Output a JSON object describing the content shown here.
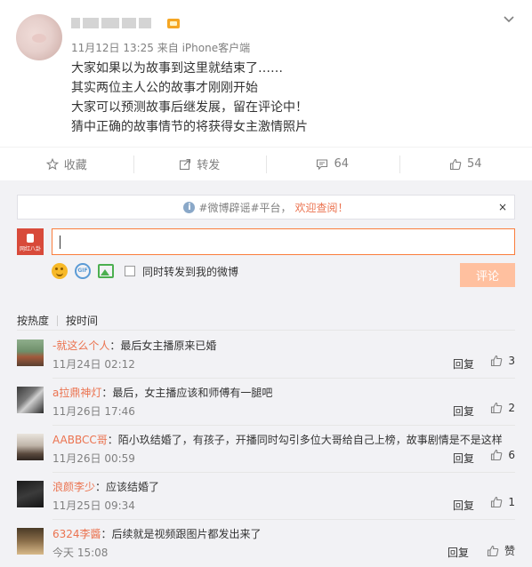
{
  "post": {
    "meta": "11月12日 13:25 来自 iPhone客户端",
    "lines": [
      "大家如果以为故事到这里就结束了……",
      "其实两位主人公的故事才刚刚开始",
      "大家可以预测故事后继发展，留在评论中！",
      "猜中正确的故事情节的将获得女主激情照片"
    ]
  },
  "actions": {
    "favorite_label": "收藏",
    "forward_label": "转发",
    "comment_count": "64",
    "like_count": "54"
  },
  "notice": {
    "prefix": "#微博辟谣#平台，",
    "link": "欢迎查阅！",
    "close": "×"
  },
  "composer": {
    "avatar_text": "网红八卦",
    "forward_option": "同时转发到我的微博",
    "submit_label": "评论"
  },
  "sort": {
    "hot": "按热度",
    "time": "按时间"
  },
  "comments": [
    {
      "user": "-就这么个人",
      "text": "：最后女主播原来已婚",
      "time": "11月24日 02:12",
      "reply": "回复",
      "likes": "3"
    },
    {
      "user": "a拉鼎神灯",
      "text": "：最后，女主播应该和师傅有一腿吧",
      "time": "11月26日 17:46",
      "reply": "回复",
      "likes": "2"
    },
    {
      "user": "AABBCC哥",
      "text": "：陌小玖结婚了，有孩子，开播同时勾引多位大哥给自己上榜，故事剧情是不是这样",
      "time": "11月26日 00:59",
      "reply": "回复",
      "likes": "6"
    },
    {
      "user": "浪颜李少",
      "text": "：应该结婚了",
      "time": "11月25日 09:34",
      "reply": "回复",
      "likes": "1"
    },
    {
      "user": "6324李醬",
      "text": "：后续就是视频跟图片都发出来了",
      "time": "今天 15:08",
      "reply": "回复",
      "likes": "赞"
    }
  ],
  "colors": {
    "accent": "#eb7350",
    "input_border": "#fa7d3c",
    "submit_disabled": "#ffc09f",
    "muted": "#808080"
  },
  "icons": [
    "chevron-down-icon",
    "star-icon",
    "share-icon",
    "comment-icon",
    "thumb-up-icon",
    "info-icon",
    "close-icon",
    "emoji-icon",
    "gif-icon",
    "image-icon"
  ]
}
